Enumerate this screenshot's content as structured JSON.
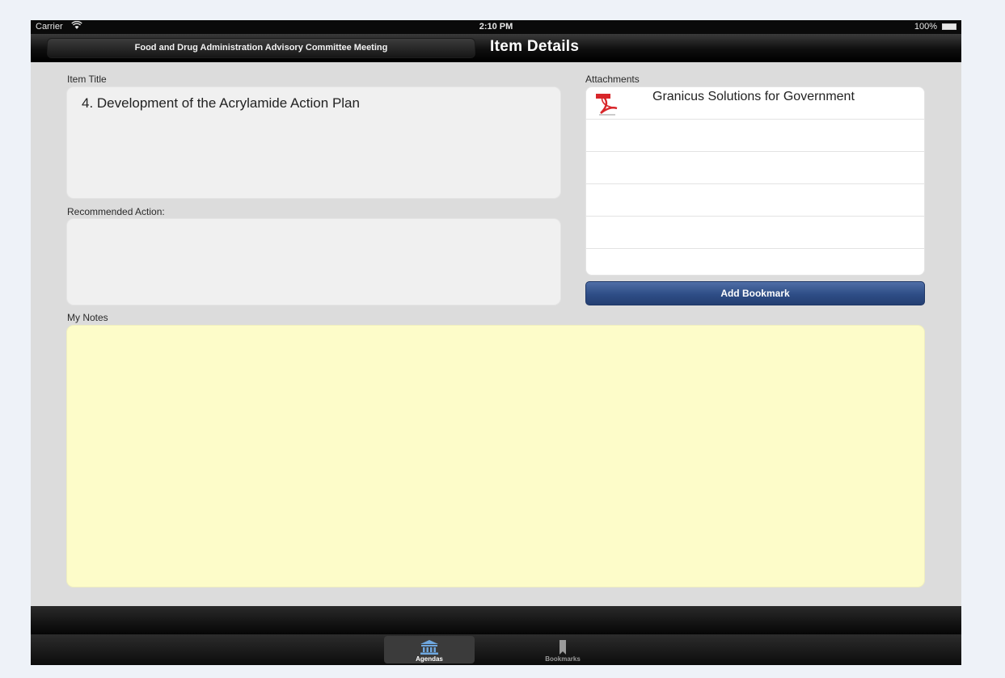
{
  "status_bar": {
    "carrier": "Carrier",
    "time": "2:10 PM",
    "battery": "100%"
  },
  "nav": {
    "back_label": "Food and Drug Administration Advisory Committee Meeting",
    "title": "Item Details"
  },
  "item_title": {
    "label": "Item Title",
    "value": "4. Development of the Acrylamide Action Plan"
  },
  "recommended_action": {
    "label": "Recommended Action:",
    "value": ""
  },
  "attachments": {
    "label": "Attachments",
    "items": [
      {
        "name": "Granicus Solutions for Government",
        "icon": "pdf-icon"
      },
      {
        "name": ""
      },
      {
        "name": ""
      },
      {
        "name": ""
      },
      {
        "name": ""
      },
      {
        "name": ""
      }
    ]
  },
  "add_bookmark_label": "Add Bookmark",
  "notes": {
    "label": "My Notes",
    "value": ""
  },
  "tabs": [
    {
      "label": "Agendas",
      "icon": "building-icon",
      "active": true
    },
    {
      "label": "Bookmarks",
      "icon": "bookmark-icon",
      "active": false
    }
  ],
  "colors": {
    "notes_bg": "#fdfcc9",
    "button_blue": "#2e4d86",
    "pdf_red": "#d8262a"
  }
}
